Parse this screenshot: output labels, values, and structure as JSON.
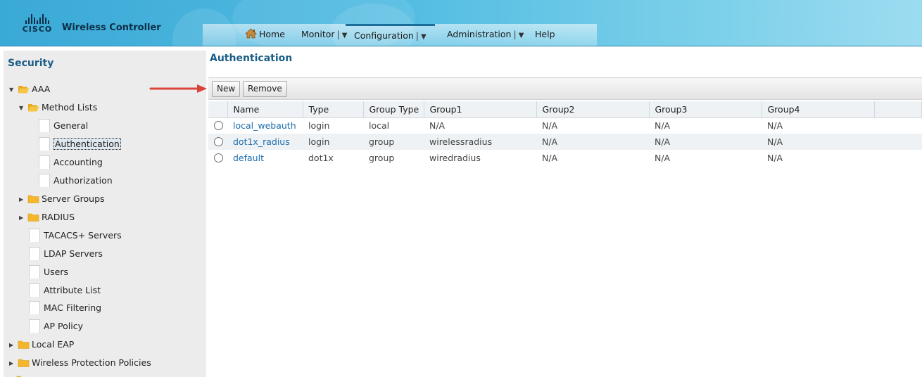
{
  "header": {
    "logo_text": "CISCO",
    "app_title": "Wireless Controller",
    "nav": [
      {
        "label": "Home",
        "icon": "home-icon"
      },
      {
        "label": "Monitor",
        "has_dropdown": true
      },
      {
        "label": "Configuration",
        "has_dropdown": true,
        "active": true
      },
      {
        "label": "Administration",
        "has_dropdown": true
      },
      {
        "label": "Help"
      }
    ]
  },
  "sidebar": {
    "title": "Security",
    "items": [
      {
        "label": "AAA",
        "type": "folder",
        "expanded": true
      },
      {
        "label": "Method Lists",
        "type": "folder",
        "expanded": true
      },
      {
        "label": "General",
        "type": "page"
      },
      {
        "label": "Authentication",
        "type": "page",
        "selected": true
      },
      {
        "label": "Accounting",
        "type": "page"
      },
      {
        "label": "Authorization",
        "type": "page"
      },
      {
        "label": "Server Groups",
        "type": "folder",
        "expanded": false
      },
      {
        "label": "RADIUS",
        "type": "folder",
        "expanded": false
      },
      {
        "label": "TACACS+ Servers",
        "type": "page"
      },
      {
        "label": "LDAP Servers",
        "type": "page"
      },
      {
        "label": "Users",
        "type": "page"
      },
      {
        "label": "Attribute List",
        "type": "page"
      },
      {
        "label": "MAC Filtering",
        "type": "page"
      },
      {
        "label": "AP Policy",
        "type": "page"
      },
      {
        "label": "Local EAP",
        "type": "folder",
        "expanded": false
      },
      {
        "label": "Wireless Protection Policies",
        "type": "folder",
        "expanded": false
      }
    ]
  },
  "main": {
    "title": "Authentication",
    "toolbar": {
      "new_label": "New",
      "remove_label": "Remove"
    },
    "table": {
      "columns": [
        "Name",
        "Type",
        "Group Type",
        "Group1",
        "Group2",
        "Group3",
        "Group4"
      ],
      "rows": [
        [
          "local_webauth",
          "login",
          "local",
          "N/A",
          "N/A",
          "N/A",
          "N/A"
        ],
        [
          "dot1x_radius",
          "login",
          "group",
          "wirelessradius",
          "N/A",
          "N/A",
          "N/A"
        ],
        [
          "default",
          "dot1x",
          "group",
          "wiredradius",
          "N/A",
          "N/A",
          "N/A"
        ]
      ]
    }
  },
  "colors": {
    "header_gradient_start": "#3aa9d6",
    "header_gradient_end": "#9ddcf0",
    "title_blue": "#1a5d87",
    "link_blue": "#1c6fb0",
    "annotation_arrow": "#d9443a"
  }
}
